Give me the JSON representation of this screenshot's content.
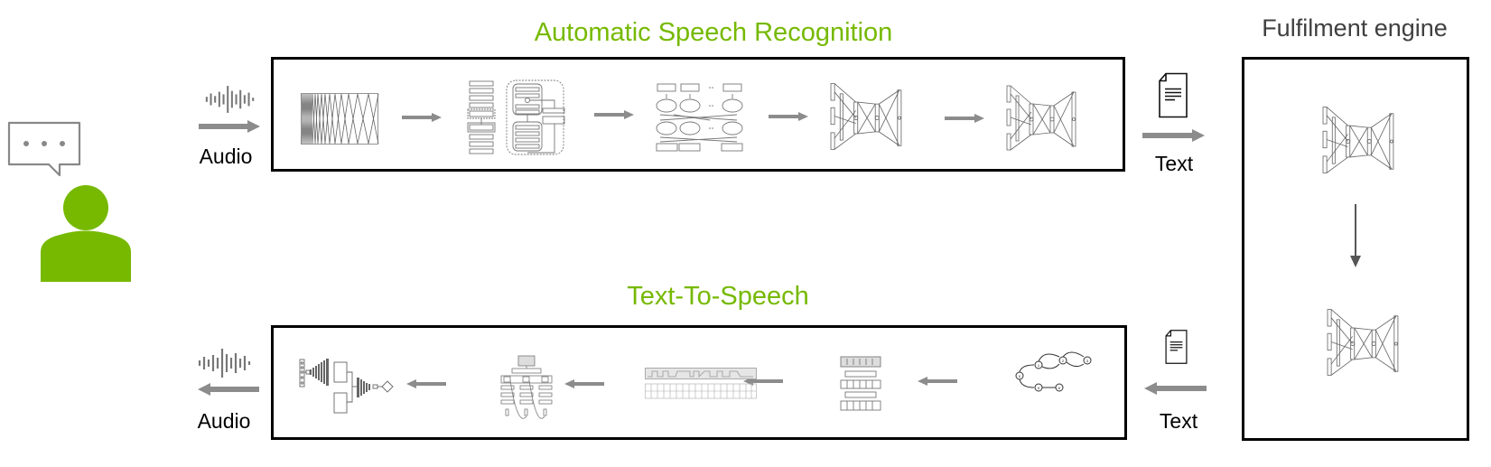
{
  "colors": {
    "accent_green": "#76b900",
    "arrow_gray": "#8c8c8c",
    "title_gray": "#404040",
    "line_dark": "#555555",
    "box_border": "#000000"
  },
  "user": {
    "icon": "person-icon",
    "bubble_icon": "speech-bubble-icon"
  },
  "asr": {
    "title": "Automatic Speech Recognition",
    "input_label": "Audio",
    "input_icon": "audio-waveform-icon",
    "output_label": "Text",
    "output_icon": "document-icon",
    "stages": [
      {
        "icon": "spectrogram-filterbank-icon"
      },
      {
        "icon": "acoustic-model-network-icon"
      },
      {
        "icon": "bidirectional-rnn-icon"
      },
      {
        "icon": "neural-network-icon"
      },
      {
        "icon": "neural-network-icon"
      }
    ]
  },
  "fulfilment": {
    "title": "Fulfilment engine",
    "stages": [
      {
        "icon": "neural-network-icon"
      },
      {
        "icon": "neural-network-icon"
      }
    ]
  },
  "tts": {
    "title": "Text-To-Speech",
    "input_label": "Text",
    "input_icon": "document-icon",
    "output_label": "Audio",
    "output_icon": "audio-waveform-icon",
    "stages": [
      {
        "icon": "text-graph-icon"
      },
      {
        "icon": "encoder-decoder-icon"
      },
      {
        "icon": "duration-alignment-icon"
      },
      {
        "icon": "attention-network-icon"
      },
      {
        "icon": "vocoder-icon"
      }
    ]
  }
}
